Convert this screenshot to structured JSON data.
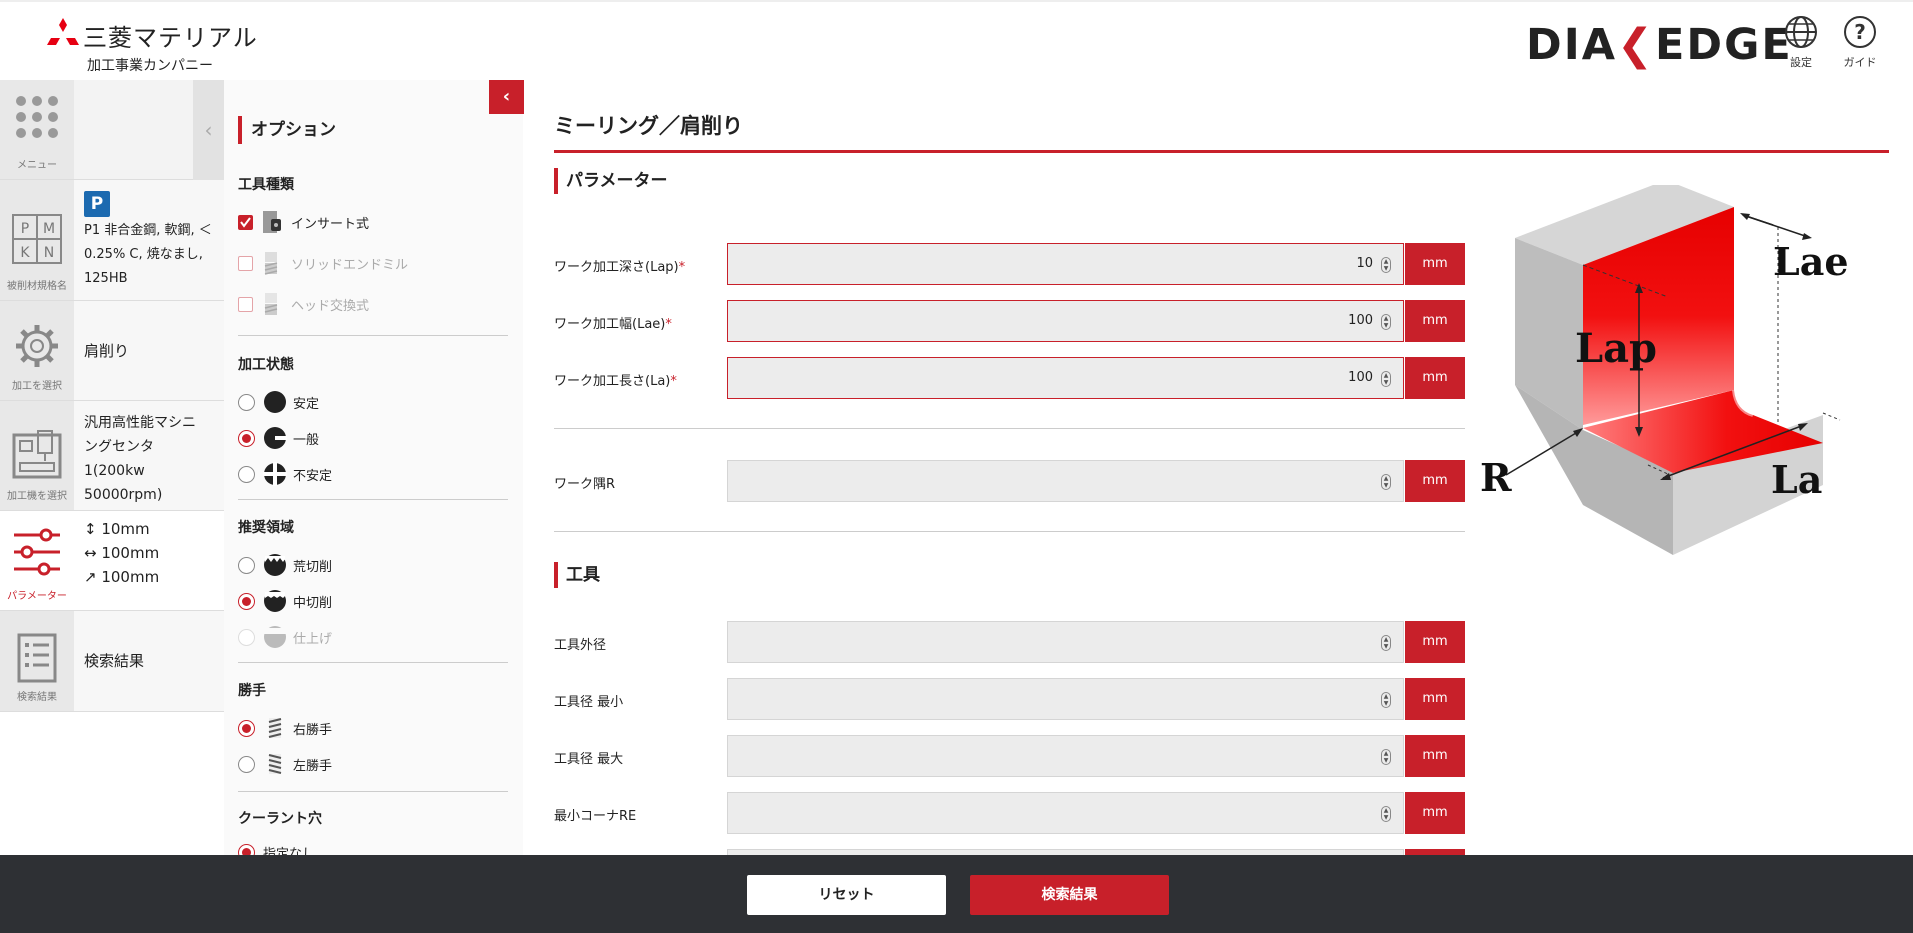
{
  "header": {
    "company": "三菱マテリアル",
    "company_sub": "加工事業カンパニー",
    "brand": "DIAEDGE",
    "brand_left": "DIA",
    "brand_right": "EDGE",
    "settings_label": "設定",
    "guide_label": "ガイド"
  },
  "rail": {
    "menu_label": "メニュー",
    "material": {
      "icon_label": "被削材規格名",
      "badge": "P",
      "text": "P1 非合金鋼, 軟鋼, ＜0.25% C, 焼なまし, 125HB",
      "icon_letters": [
        "P",
        "M",
        "K",
        "N"
      ]
    },
    "process": {
      "icon_label": "加工を選択",
      "text": "肩削り"
    },
    "machine": {
      "icon_label": "加工機を選択",
      "text": "汎用高性能マシニングセンタ1(200kw 50000rpm)"
    },
    "parameter": {
      "icon_label": "パラメーター",
      "lines": [
        "↕ 10mm",
        "↔ 100mm",
        "↗ 100mm"
      ]
    },
    "result": {
      "icon_label": "検索結果",
      "text": "検索結果"
    }
  },
  "options": {
    "title": "オプション",
    "tool_type": {
      "title": "工具種類",
      "items": [
        {
          "label": "インサート式",
          "checked": true,
          "enabled": true
        },
        {
          "label": "ソリッドエンドミル",
          "checked": false,
          "enabled": false
        },
        {
          "label": "ヘッド交換式",
          "checked": false,
          "enabled": false
        }
      ]
    },
    "condition": {
      "title": "加工状態",
      "items": [
        {
          "label": "安定",
          "selected": false
        },
        {
          "label": "一般",
          "selected": true
        },
        {
          "label": "不安定",
          "selected": false
        }
      ]
    },
    "region": {
      "title": "推奨領域",
      "items": [
        {
          "label": "荒切削",
          "selected": false,
          "enabled": true
        },
        {
          "label": "中切削",
          "selected": true,
          "enabled": true
        },
        {
          "label": "仕上げ",
          "selected": false,
          "enabled": false
        }
      ]
    },
    "hand": {
      "title": "勝手",
      "items": [
        {
          "label": "右勝手",
          "selected": true
        },
        {
          "label": "左勝手",
          "selected": false
        }
      ]
    },
    "coolant": {
      "title": "クーラント穴",
      "items": [
        {
          "label": "指定なし",
          "selected": true
        }
      ]
    }
  },
  "main": {
    "title": "ミーリング／肩削り",
    "param_section": "パラメーター",
    "tool_section": "工具",
    "unit": "mm",
    "params": [
      {
        "label": "ワーク加工深さ(Lap)",
        "required": "*",
        "value": "10"
      },
      {
        "label": "ワーク加工幅(Lae)",
        "required": "*",
        "value": "100"
      },
      {
        "label": "ワーク加工長さ(La)",
        "required": "*",
        "value": "100"
      }
    ],
    "corner": {
      "label": "ワーク隅R",
      "value": ""
    },
    "tools": [
      {
        "label": "工具外径",
        "value": ""
      },
      {
        "label": "工具径 最小",
        "value": ""
      },
      {
        "label": "工具径 最大",
        "value": ""
      },
      {
        "label": "最小コーナRE",
        "value": ""
      }
    ],
    "diagram_labels": {
      "lae": "Lae",
      "lap": "Lap",
      "la": "La",
      "r": "R"
    }
  },
  "footer": {
    "reset_label": "リセット",
    "search_label": "検索結果"
  },
  "colors": {
    "accent": "#c8202a",
    "footer": "#2e3034",
    "badge": "#1c6ab0"
  }
}
